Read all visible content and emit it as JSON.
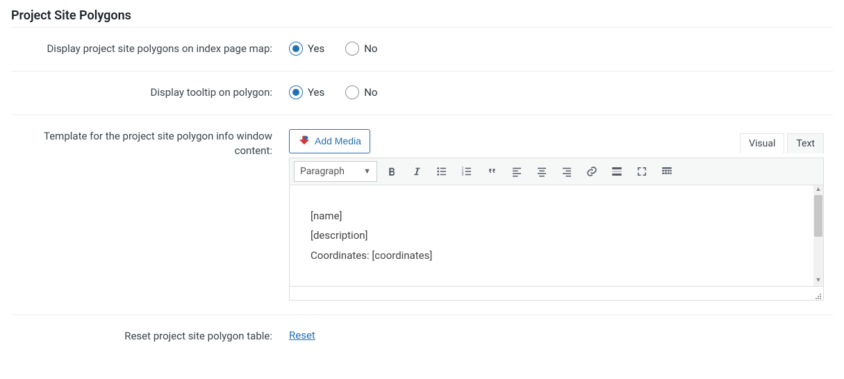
{
  "section_title": "Project Site Polygons",
  "rows": {
    "display_on_index": {
      "label": "Display project site polygons on index page map:",
      "options": {
        "yes": "Yes",
        "no": "No"
      },
      "selected": "yes"
    },
    "display_tooltip": {
      "label": "Display tooltip on polygon:",
      "options": {
        "yes": "Yes",
        "no": "No"
      },
      "selected": "yes"
    },
    "template": {
      "label": "Template for the project site polygon info window content:",
      "add_media": "Add Media",
      "tabs": {
        "visual": "Visual",
        "text": "Text"
      },
      "active_tab": "visual",
      "format_selector": "Paragraph",
      "content_lines": [
        "[name]",
        "[description]",
        "Coordinates: [coordinates]"
      ]
    },
    "reset": {
      "label": "Reset project site polygon table:",
      "link_text": "Reset"
    }
  },
  "icons": {
    "add_media": "media-icon"
  }
}
